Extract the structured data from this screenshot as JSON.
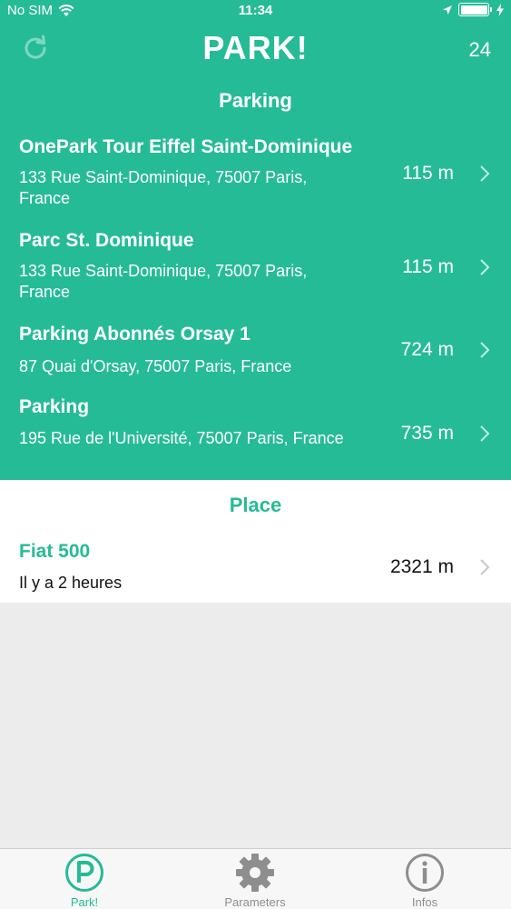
{
  "status_bar": {
    "carrier": "No SIM",
    "time": "11:34"
  },
  "header": {
    "title": "PARK!",
    "count": "24",
    "refresh_icon": "refresh-icon"
  },
  "parking": {
    "section_title": "Parking",
    "items": [
      {
        "name": "OnePark Tour Eiffel Saint-Dominique",
        "address": "133 Rue Saint-Dominique, 75007 Paris, France",
        "distance": "115 m"
      },
      {
        "name": "Parc St. Dominique",
        "address": "133 Rue Saint-Dominique, 75007 Paris, France",
        "distance": "115 m"
      },
      {
        "name": "Parking Abonnés Orsay 1",
        "address": "87 Quai d'Orsay, 75007 Paris, France",
        "distance": "724 m"
      },
      {
        "name": "Parking",
        "address": "195 Rue de l'Université, 75007 Paris, France",
        "distance": "735 m"
      }
    ]
  },
  "place": {
    "section_title": "Place",
    "item": {
      "name": "Fiat 500",
      "subtitle": "Il y a 2 heures",
      "distance": "2321 m"
    }
  },
  "tabs": [
    {
      "label": "Park!",
      "icon": "parking-icon",
      "active": true
    },
    {
      "label": "Parameters",
      "icon": "gear-icon",
      "active": false
    },
    {
      "label": "Infos",
      "icon": "info-icon",
      "active": false
    }
  ],
  "colors": {
    "accent": "#26bb97",
    "background": "#ececec",
    "inactive": "#8e8e8e"
  }
}
